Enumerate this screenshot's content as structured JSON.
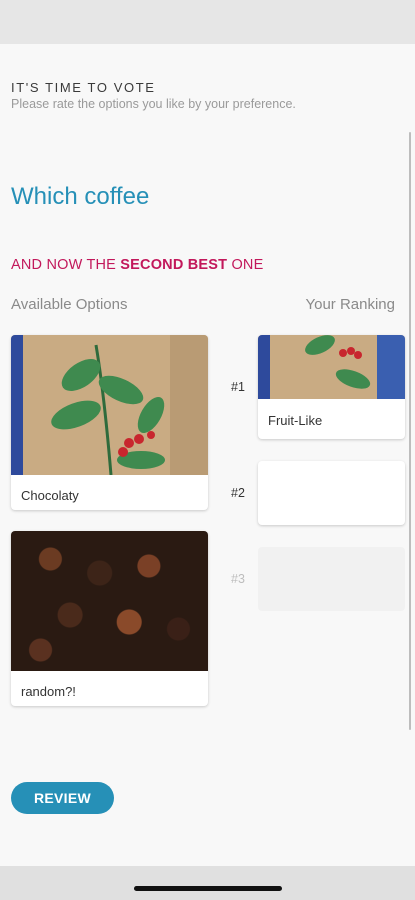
{
  "header": {
    "eyebrow": "IT'S TIME TO VOTE",
    "subtitle": "Please rate the options you like by your preference."
  },
  "question": "Which coffee",
  "prompt": {
    "prefix": "AND NOW THE ",
    "emphasis": "SECOND BEST",
    "suffix": " ONE"
  },
  "columns": {
    "available_label": "Available Options",
    "ranking_label": "Your Ranking"
  },
  "available_options": [
    {
      "label": "Chocolaty",
      "image": "coffee-bag-photo"
    },
    {
      "label": "random?!",
      "image": "coffee-beans-photo"
    }
  ],
  "ranking": [
    {
      "rank": "#1",
      "label": "Fruit-Like",
      "image": "coffee-bag-photo"
    },
    {
      "rank": "#2",
      "label": ""
    },
    {
      "rank": "#3",
      "label": ""
    }
  ],
  "review_button": "REVIEW",
  "colors": {
    "accent": "#2690b7",
    "prompt": "#c2185b"
  }
}
